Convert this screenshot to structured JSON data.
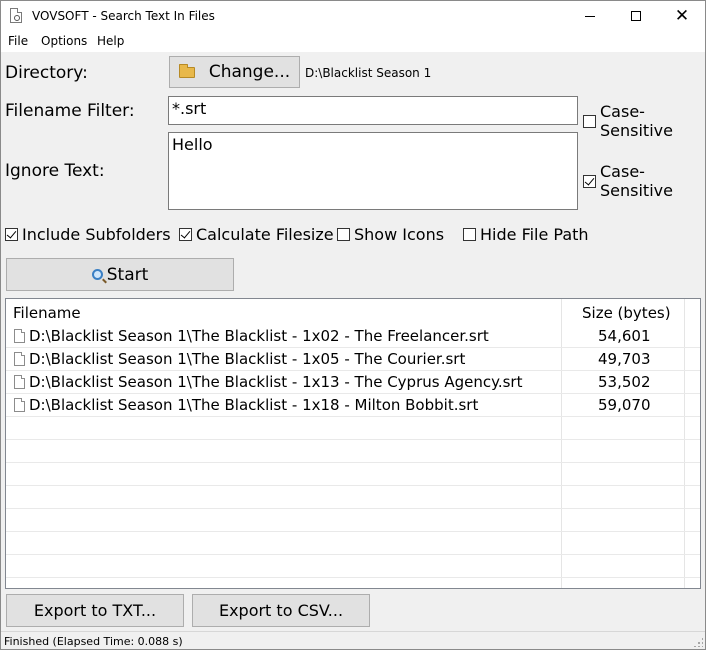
{
  "window": {
    "title": "VOVSOFT - Search Text In Files",
    "controls": {
      "minimize_icon": "minimize-icon",
      "maximize_icon": "maximize-icon",
      "close_label": "✕"
    }
  },
  "menu": {
    "items": [
      {
        "label": "File"
      },
      {
        "label": "Options"
      },
      {
        "label": "Help"
      }
    ]
  },
  "form": {
    "directory_label": "Directory:",
    "change_button_label": "Change...",
    "directory_value": "D:\\Blacklist Season 1",
    "filename_filter_label": "Filename Filter:",
    "filename_filter_value": "*.srt",
    "filter_case_sensitive": {
      "label": "Case-Sensitive",
      "checked": false
    },
    "ignore_text_label": "Ignore Text:",
    "ignore_text_value": "Hello",
    "ignore_case_sensitive": {
      "label": "Case-Sensitive",
      "checked": true
    }
  },
  "options": [
    {
      "label": "Include Subfolders",
      "checked": true
    },
    {
      "label": "Calculate Filesize",
      "checked": true
    },
    {
      "label": "Show Icons",
      "checked": false
    },
    {
      "label": "Hide File Path",
      "checked": false
    }
  ],
  "start_button_label": "Start",
  "results": {
    "columns": [
      {
        "label": "Filename"
      },
      {
        "label": "Size (bytes)"
      }
    ],
    "rows": [
      {
        "filename": "D:\\Blacklist Season 1\\The Blacklist - 1x02 - The Freelancer.srt",
        "size": "54,601"
      },
      {
        "filename": "D:\\Blacklist Season 1\\The Blacklist - 1x05 - The Courier.srt",
        "size": "49,703"
      },
      {
        "filename": "D:\\Blacklist Season 1\\The Blacklist - 1x13 - The Cyprus Agency.srt",
        "size": "53,502"
      },
      {
        "filename": "D:\\Blacklist Season 1\\The Blacklist - 1x18 - Milton Bobbit.srt",
        "size": "59,070"
      }
    ]
  },
  "export": {
    "txt_label": "Export to TXT...",
    "csv_label": "Export to CSV..."
  },
  "status": {
    "text": "Finished (Elapsed Time: 0.088 s)"
  }
}
